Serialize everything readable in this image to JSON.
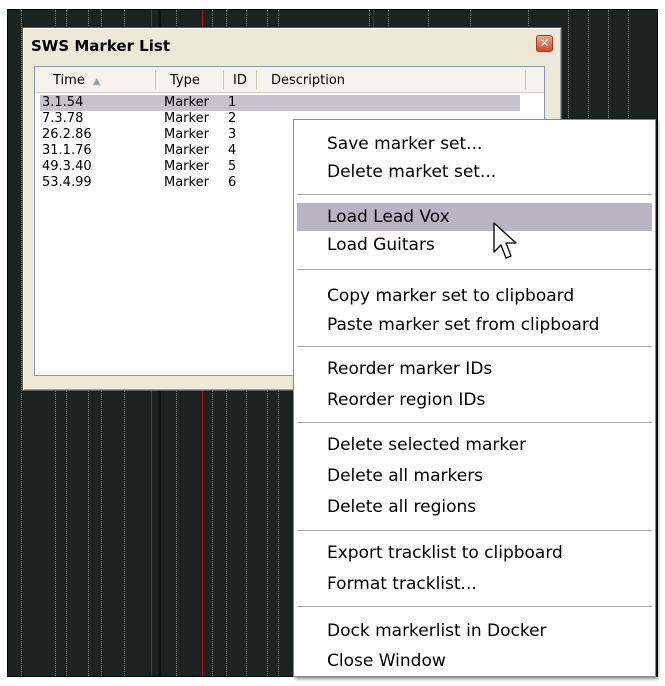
{
  "window": {
    "title": "SWS Marker List",
    "close_glyph": "✕"
  },
  "list": {
    "columns": [
      "Time",
      "Type",
      "ID",
      "Description"
    ],
    "sort_indicator": "▲",
    "rows": [
      {
        "time": "3.1.54",
        "type": "Marker",
        "id": "1",
        "description": ""
      },
      {
        "time": "7.3.78",
        "type": "Marker",
        "id": "2",
        "description": ""
      },
      {
        "time": "26.2.86",
        "type": "Marker",
        "id": "3",
        "description": ""
      },
      {
        "time": "31.1.76",
        "type": "Marker",
        "id": "4",
        "description": ""
      },
      {
        "time": "49.3.40",
        "type": "Marker",
        "id": "5",
        "description": ""
      },
      {
        "time": "53.4.99",
        "type": "Marker",
        "id": "6",
        "description": ""
      }
    ],
    "selected_row": 0
  },
  "context_menu": {
    "items": [
      "Save marker set...",
      "Delete market set...",
      "Load Lead Vox",
      "Load Guitars",
      "Copy marker set to clipboard",
      "Paste marker set from clipboard",
      "Reorder marker IDs",
      "Reorder region IDs",
      "Delete selected marker",
      "Delete all markers",
      "Delete all regions",
      "Export tracklist to clipboard",
      "Format tracklist...",
      "Dock markerlist in Docker",
      "Close Window"
    ],
    "highlighted": "Load Lead Vox"
  },
  "colors": {
    "timeline_bg": "#1b2220",
    "marker_line": "#b01010",
    "menu_highlight": "#b8b4c2",
    "selected_row": "#c6c3cd"
  },
  "icons": [
    "close-icon",
    "sort-ascending-icon",
    "mouse-pointer-icon"
  ]
}
